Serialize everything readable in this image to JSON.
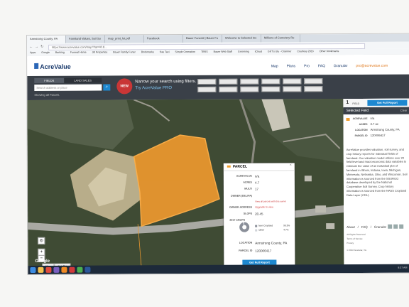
{
  "browser": {
    "tabs": [
      "Armstrong County, PA",
      "Farmland Values, Soil Su",
      "map_print_lot.pdf",
      "Facebook",
      "Bauer Funeral | Bauer Fu",
      "Welcome to Selected Ins",
      "Millions of Cemetery Re"
    ],
    "url": "https://www.acrevalue.com/map/?lat=40.8...",
    "bookmarks": [
      "Apps",
      "Google",
      "Banking",
      "Funeral Home",
      "Jill Properties",
      "Bauer Family Funer",
      "Bookmarks",
      "Kau Taxi",
      "Simple Cremation",
      "TBRS",
      "Bauer Web Staff",
      "Grooming",
      "iCloud",
      "GKT's Ulu - Cranmer",
      "Courtesy 2016",
      "Other bookmarks"
    ]
  },
  "site": {
    "brand": "AcreValue",
    "nav": [
      "Map",
      "Plans",
      "Pro",
      "FAQ",
      "Granular"
    ],
    "pro_link": "pro@acrevalue.com"
  },
  "search": {
    "tabs": [
      "FIELDS",
      "LAND SALES"
    ],
    "placeholder": "Search address or place",
    "new_badge": "NEW",
    "narrow_text": "Narrow your search using filters.",
    "try_text": "Try AcreValue PRO",
    "showing": "Showing all Parcels."
  },
  "map": {
    "google": "Google",
    "map_types": [
      "Map",
      "Satellite"
    ],
    "credit": "Map data ©2016 Google Imagery ©2016, DigitalGlobe, U.S. Geol."
  },
  "popup": {
    "title": "PARCEL",
    "rows": [
      {
        "key": "ACREVALUE",
        "value": "n/a"
      },
      {
        "key": "ACRES",
        "value": "4.7"
      },
      {
        "key": "MULTI",
        "value": "17"
      },
      {
        "key": "OWNER (DEL/PA)",
        "value": "View all parcels with this owner"
      },
      {
        "key": "OWNER ADDRESS",
        "value": "Upgrade to view"
      },
      {
        "key": "SLOPE",
        "value": "20.45"
      },
      {
        "key": "2017 CROPS",
        "value": ""
      },
      {
        "key": "LOCATION",
        "value": "Armstrong County, PA"
      },
      {
        "key": "PARCEL ID",
        "value": "120006417"
      }
    ],
    "crops": [
      {
        "name": "Non-Cropland",
        "pct": "95.3%",
        "color": "#8a8f99"
      },
      {
        "name": "Other",
        "pct": "4.7%",
        "color": "#cfd3d8"
      }
    ],
    "crop_share": 0.95,
    "button": "Get Full Report"
  },
  "panel": {
    "field_count": "1",
    "field_label": "FIELD",
    "report_btn": "Get Full Report",
    "selected": "Selected Field",
    "clear": "Clear",
    "rows": [
      {
        "key": "ACREVALUE",
        "value": "n/a"
      },
      {
        "key": "ACRES",
        "value": "4.7 ac"
      },
      {
        "key": "LOCATION",
        "value": "Armstrong County, PA"
      },
      {
        "key": "PARCEL ID",
        "value": "120006417"
      }
    ],
    "description": "AcreValue provides valuation, soil survey, and crop history reports for individual fields of farmland. Our valuation model utilizes over 20 field-level and macroeconomic data variables to estimate the value of an individual plot of farmland in Illinois, Indiana, Iowa, Michigan, Minnesota, Nebraska, Ohio, and Wisconsin. Soil information is sourced from the SSURGO database developed by the National Cooperative Soil Survey. Crop history information is sourced from the NASS Cropland Data Layer (CDL).",
    "footer_nav": [
      "About",
      "FAQ",
      "Granular"
    ],
    "legal": [
      "All Rights Reserved",
      "Terms of Service",
      "Privacy",
      "© 2016 Granular, Inc."
    ]
  },
  "taskbar": {
    "clock": "9:37 AM"
  }
}
